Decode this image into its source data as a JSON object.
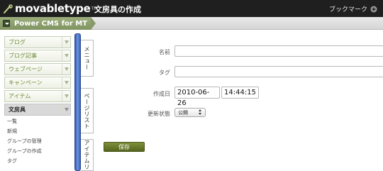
{
  "header": {
    "logo_text": "movabletype",
    "logo_tm": "TM",
    "page_title": "文房具の作成",
    "bookmark_label": "ブックマーク",
    "bookmark_icon": "plus-bookmark-icon"
  },
  "blog_bar": {
    "blog_name": "Power CMS for MT",
    "toggle_icon": "chevron-down-icon",
    "accent_color": "#87996a"
  },
  "sidebar": {
    "items": [
      {
        "label": "ブログ"
      },
      {
        "label": "ブログ記事"
      },
      {
        "label": "ウェブページ"
      },
      {
        "label": "キャンペーン"
      },
      {
        "label": "アイテム"
      },
      {
        "label": "文房具"
      }
    ],
    "submenu": [
      {
        "label": "一覧"
      },
      {
        "label": "新規"
      },
      {
        "label": "グループの管理"
      },
      {
        "label": "グループの作成"
      },
      {
        "label": "タグ"
      }
    ]
  },
  "side_tabs": [
    {
      "label": "メニュー"
    },
    {
      "label": "ページリスト"
    },
    {
      "label": "アイテムリ"
    }
  ],
  "form": {
    "name_label": "名前",
    "name_value": "",
    "tag_label": "タグ",
    "tag_value": "",
    "created_label": "作成日",
    "created_date": "2010-06-26",
    "created_time": "14:44:15",
    "status_label": "更新状態",
    "status_value": "公開",
    "save_label": "保存"
  }
}
